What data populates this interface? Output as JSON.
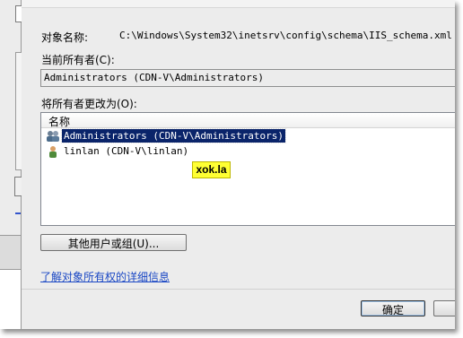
{
  "dialog": {
    "object_name_label": "对象名称:",
    "object_name_value": "C:\\Windows\\System32\\inetsrv\\config\\schema\\IIS_schema.xml",
    "current_owner_label": "当前所有者(C):",
    "current_owner_value": "Administrators (CDN-V\\Administrators)",
    "change_owner_label": "将所有者更改为(O):",
    "list_header": "名称",
    "list_items": [
      {
        "label": "Administrators (CDN-V\\Administrators)",
        "icon": "user-group-icon",
        "selected": true
      },
      {
        "label": "linlan (CDN-V\\linlan)",
        "icon": "user-icon",
        "selected": false
      }
    ],
    "other_users_button": "其他用户或组(U)...",
    "learn_more_link": "了解对象所有权的详细信息",
    "ok_button": "确定"
  },
  "watermark": "xok.la",
  "colors": {
    "selection": "#0a246a",
    "link": "#1a47c4",
    "watermark_bg": "#ffff33",
    "dialog_bg": "#ececec"
  }
}
